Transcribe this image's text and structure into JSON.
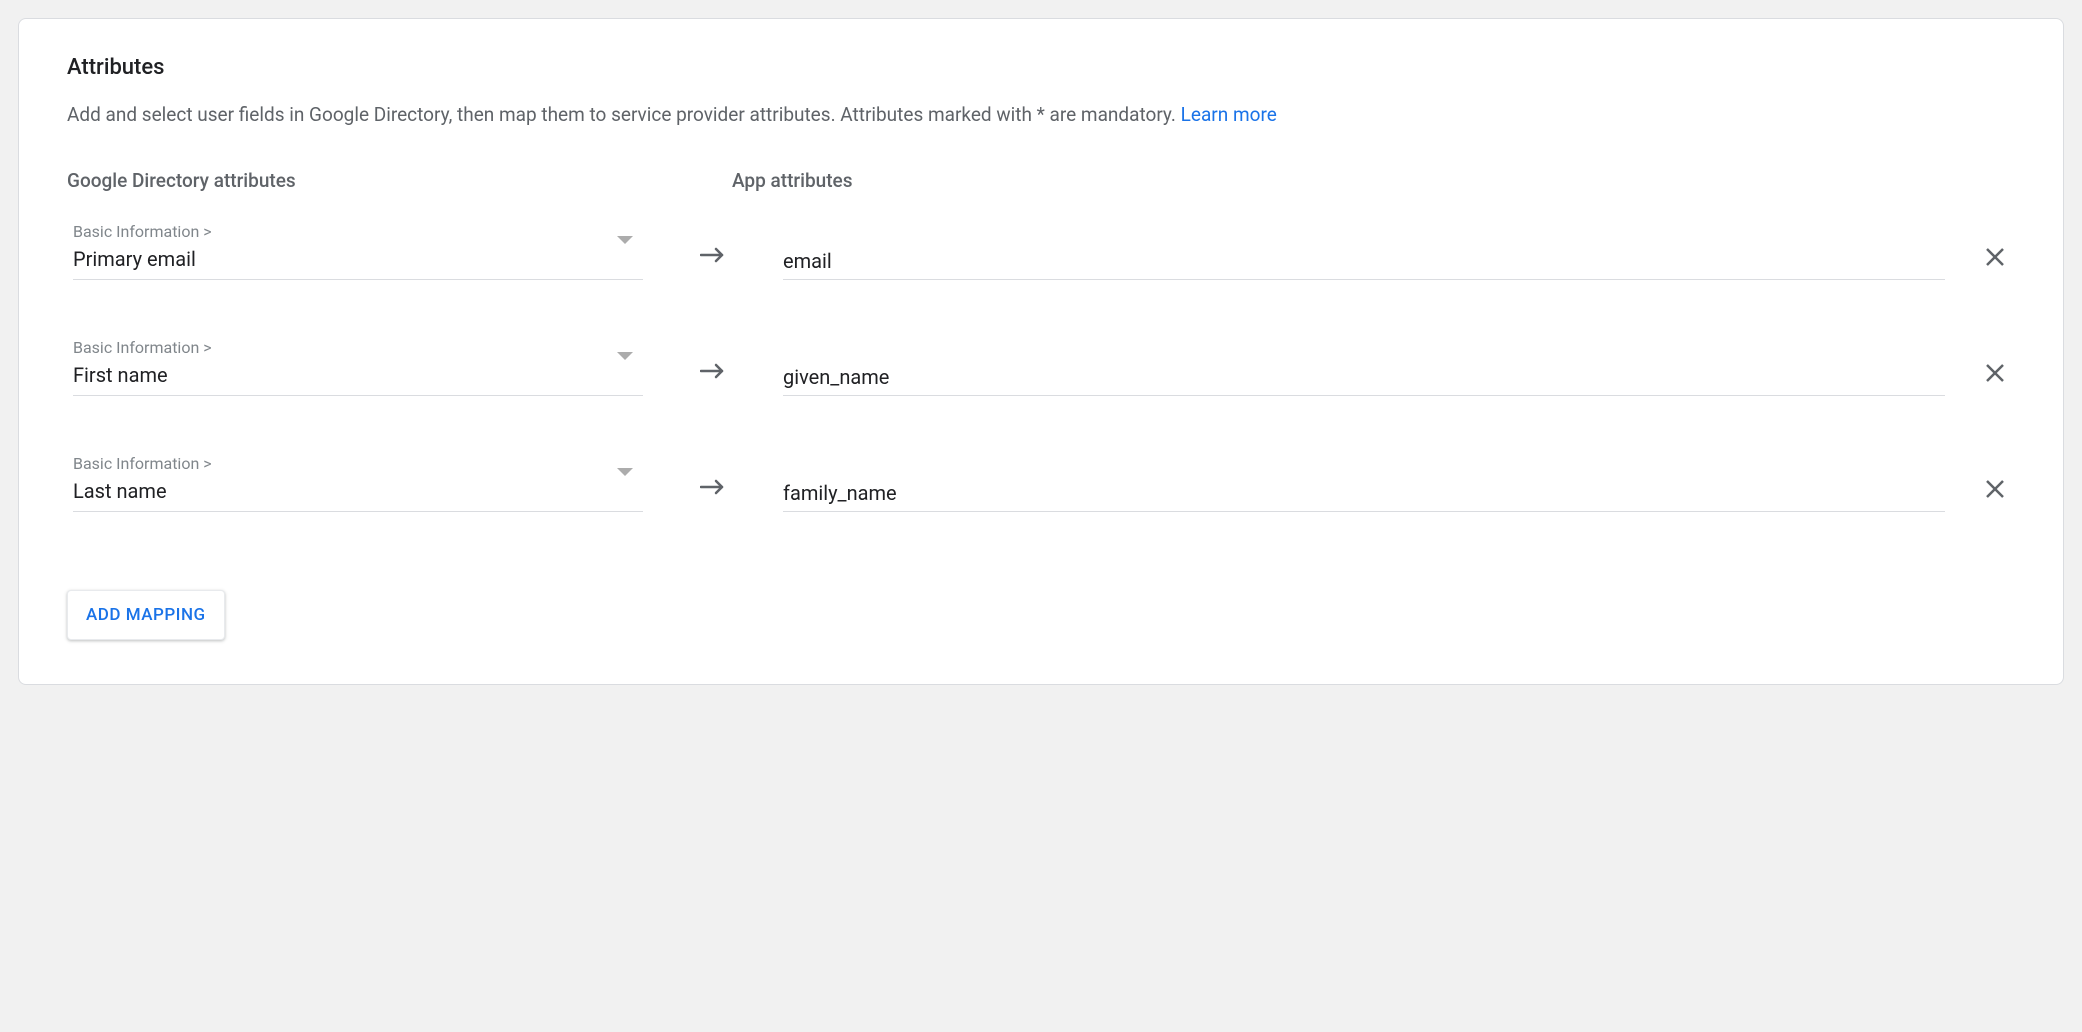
{
  "section": {
    "title": "Attributes",
    "description": "Add and select user fields in Google Directory, then map them to service provider attributes. Attributes marked with * are mandatory. ",
    "learn_more": "Learn more"
  },
  "columns": {
    "google": "Google Directory attributes",
    "app": "App attributes"
  },
  "rows": [
    {
      "category": "Basic Information >",
      "google_value": "Primary email",
      "app_value": "email"
    },
    {
      "category": "Basic Information >",
      "google_value": "First name",
      "app_value": "given_name"
    },
    {
      "category": "Basic Information >",
      "google_value": "Last name",
      "app_value": "family_name"
    }
  ],
  "add_button": "ADD MAPPING"
}
